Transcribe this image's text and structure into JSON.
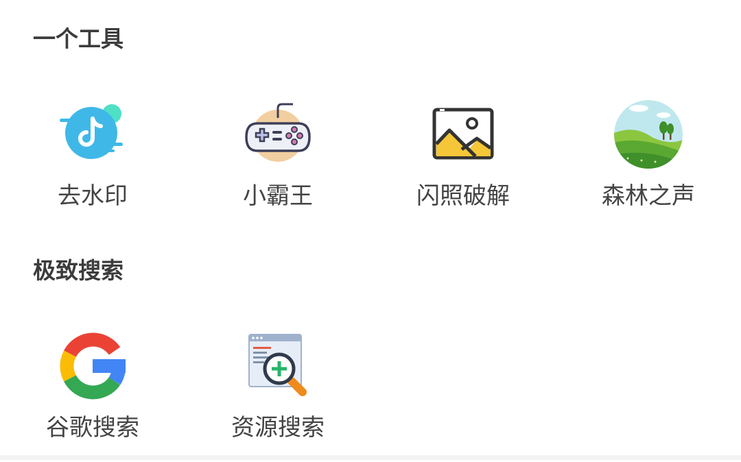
{
  "sections": [
    {
      "title": "一个工具",
      "items": [
        {
          "label": "去水印",
          "icon": "douyin-watermark-icon"
        },
        {
          "label": "小霸王",
          "icon": "gamepad-icon"
        },
        {
          "label": "闪照破解",
          "icon": "image-icon"
        },
        {
          "label": "森林之声",
          "icon": "forest-landscape-icon"
        }
      ]
    },
    {
      "title": "极致搜索",
      "items": [
        {
          "label": "谷歌搜索",
          "icon": "google-icon"
        },
        {
          "label": "资源搜索",
          "icon": "resource-search-icon"
        }
      ]
    }
  ]
}
